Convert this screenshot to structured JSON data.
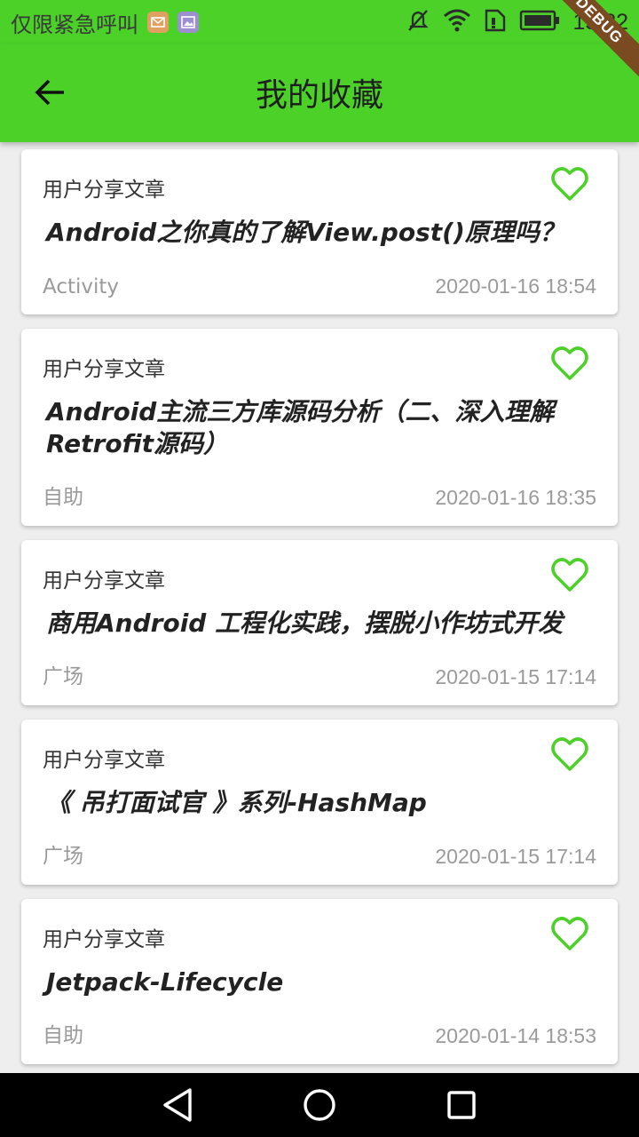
{
  "status_bar": {
    "carrier": "仅限紧急呼叫",
    "time": "15:22",
    "icons": [
      "mail-notification-icon",
      "image-notification-icon",
      "mute-icon",
      "wifi-icon",
      "sim-icon",
      "battery-icon"
    ]
  },
  "app_bar": {
    "title": "我的收藏",
    "back_icon": "arrow-left-icon",
    "debug_label": "DEBUG"
  },
  "colors": {
    "primary": "#4cd128",
    "heart": "#4cd128",
    "meta_text": "#9a9a9a"
  },
  "articles": [
    {
      "category": "用户分享文章",
      "title": "Android之你真的了解View.post()原理吗？",
      "chapter": "Activity",
      "date": "2020-01-16  18:54",
      "collected": true
    },
    {
      "category": "用户分享文章",
      "title": "Android主流三方库源码分析（二、深入理解Retrofit源码）",
      "chapter": "自助",
      "date": "2020-01-16  18:35",
      "collected": true
    },
    {
      "category": "用户分享文章",
      "title": "商用Android  工程化实践，摆脱小作坊式开发",
      "chapter": "广场",
      "date": "2020-01-15  17:14",
      "collected": true
    },
    {
      "category": "用户分享文章",
      "title": "《 吊打面试官 》系列-HashMap",
      "chapter": "广场",
      "date": "2020-01-15  17:14",
      "collected": true
    },
    {
      "category": "用户分享文章",
      "title": "Jetpack-Lifecycle",
      "chapter": "自助",
      "date": "2020-01-14  18:53",
      "collected": true
    }
  ],
  "nav_bar": {
    "buttons": [
      "back-triangle-icon",
      "home-circle-icon",
      "recents-square-icon"
    ]
  }
}
